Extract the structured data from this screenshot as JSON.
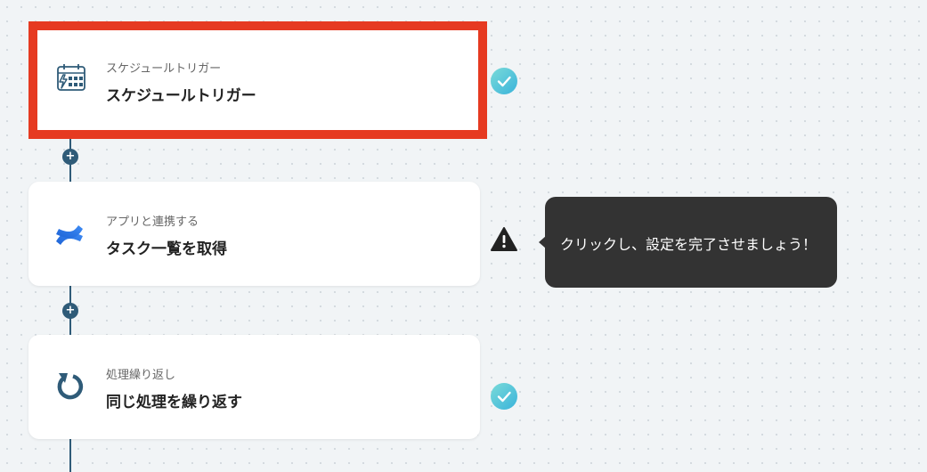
{
  "flow": {
    "steps": [
      {
        "sub": "スケジュールトリガー",
        "title": "スケジュールトリガー",
        "icon": "calendar-bolt-icon",
        "status": "complete",
        "highlighted": true
      },
      {
        "sub": "アプリと連携する",
        "title": "タスク一覧を取得",
        "icon": "confluence-logo-icon",
        "status": "warning"
      },
      {
        "sub": "処理繰り返し",
        "title": "同じ処理を繰り返す",
        "icon": "repeat-icon",
        "status": "complete"
      }
    ],
    "add_symbol": "+"
  },
  "tooltip": {
    "text": "クリックし、設定を完了させましょう！"
  },
  "colors": {
    "highlight": "#e63a21",
    "line": "#2f5b78",
    "tooltip_bg": "#333333",
    "check": "#3ab3da"
  }
}
